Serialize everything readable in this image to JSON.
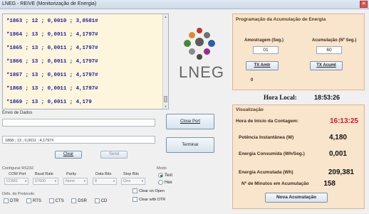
{
  "window": {
    "title": "LNEG - REIVE  (Monitorização de Energia)",
    "close_symbol": "✕"
  },
  "serial": {
    "lines": [
      "*1863 ; 12 ; 0,0010 ; 3,8581#",
      "*1864 ; 13 ; 0,0011 ; 4,1797#",
      "*1865 ; 13 ; 0,0011 ; 4,1797#",
      "*1866 ; 13 ; 0,0011 ; 4,1797#",
      "*1867 ; 13 ; 0,0011 ; 4,1797#",
      "*1868 ; 13 ; 0,0011 ; 4,1797#",
      "*1869 ; 13 ; 0,0011 ; 4,179"
    ]
  },
  "logo": {
    "text": "LNEG"
  },
  "send": {
    "label": "Envio de Dados",
    "input_value": "",
    "received_value": "1868 ; 13 ; 0,0011 ; 4,1797#",
    "clear_label": "Clear",
    "send_label": "Send"
  },
  "buttons": {
    "close_port": "Close Port",
    "terminate": "Terminar"
  },
  "rs232": {
    "title": "Configurar RS232",
    "com_port": {
      "label": "COM Port",
      "value": "COM1"
    },
    "baud": {
      "label": "Baud Rate",
      "value": "57600"
    },
    "parity": {
      "label": "Parity",
      "value": "None"
    },
    "data_bits": {
      "label": "Data Bits",
      "value": "8"
    },
    "stop_bits": {
      "label": "Stop Bits",
      "value": "One"
    }
  },
  "mode": {
    "title": "Modo",
    "text": "Text",
    "hex": "Hex"
  },
  "protocol": {
    "title": "Defs. do Protocolo",
    "checks": [
      "DTR",
      "RTS",
      "CTS",
      "DSR",
      "CD"
    ],
    "clear_on_open": "Clear on Open",
    "clear_with_dtr": "Clear with DTR"
  },
  "programming": {
    "title": "Programação da Acumulação de Energia",
    "sample_label": "Amostragem (Seg.)",
    "sample_value": "01",
    "accum_label": "Acumulação (Nº Seg.)",
    "accum_value": "60",
    "tx_amst": "TX Amtr",
    "tx_acum": "TX Acuml",
    "status": "0"
  },
  "clock": {
    "label": "Hora Local:",
    "value": "18:53:26"
  },
  "viz": {
    "title": "Visualização",
    "start_label": "Hora de Inicio da Contagem:",
    "start_value": "16:13:25",
    "power_label": "Potência Instantânea  (W)",
    "power_value": "4,180",
    "energy_label": "Energia Consumida (Wh/Seg.)",
    "energy_value": "0,001",
    "accum_label": "Energia Acumulada (Wh)",
    "accum_value": "209,381",
    "minutes_label": "Nº de Minutos em Acumulação",
    "minutes_value": "158",
    "new_accum": "Nova Acumulação"
  },
  "colors": {
    "serial_text": "#1c1ca6",
    "start_time": "#d11a2a",
    "panel_bg": "#f9e4cc"
  }
}
